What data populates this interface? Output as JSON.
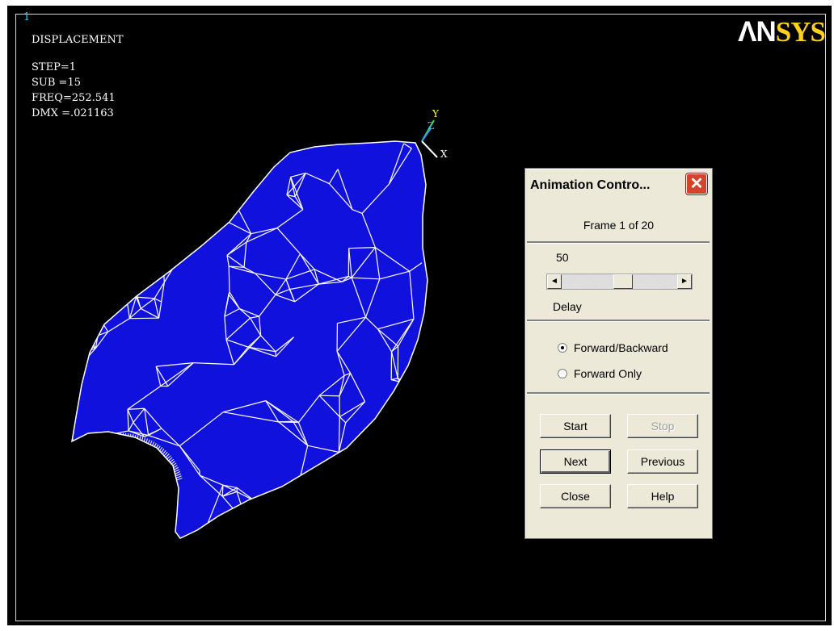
{
  "graphics": {
    "window_number": "1",
    "result_type": "DISPLACEMENT",
    "step": "STEP=1",
    "sub": "SUB =15",
    "freq": "FREQ=252.541",
    "dmx": "DMX =.021163",
    "logo_an": "ΛN",
    "logo_sys": "SYS",
    "triad": {
      "y": "Y",
      "z": "Z",
      "x": "X"
    },
    "mesh_color": "#1111dd",
    "edge_color": "#ffffff"
  },
  "dialog": {
    "title": "Animation Contro...",
    "close_symbol": "✕",
    "frame_label": "Frame  1 of 20",
    "delay_value": "50",
    "delay_label": "Delay",
    "scroll_left_symbol": "◄",
    "scroll_right_symbol": "►",
    "mode_options": [
      {
        "label": "Forward/Backward",
        "selected": true
      },
      {
        "label": "Forward Only",
        "selected": false
      }
    ],
    "buttons": {
      "start": "Start",
      "stop": "Stop",
      "next": "Next",
      "previous": "Previous",
      "close": "Close",
      "help": "Help"
    }
  }
}
